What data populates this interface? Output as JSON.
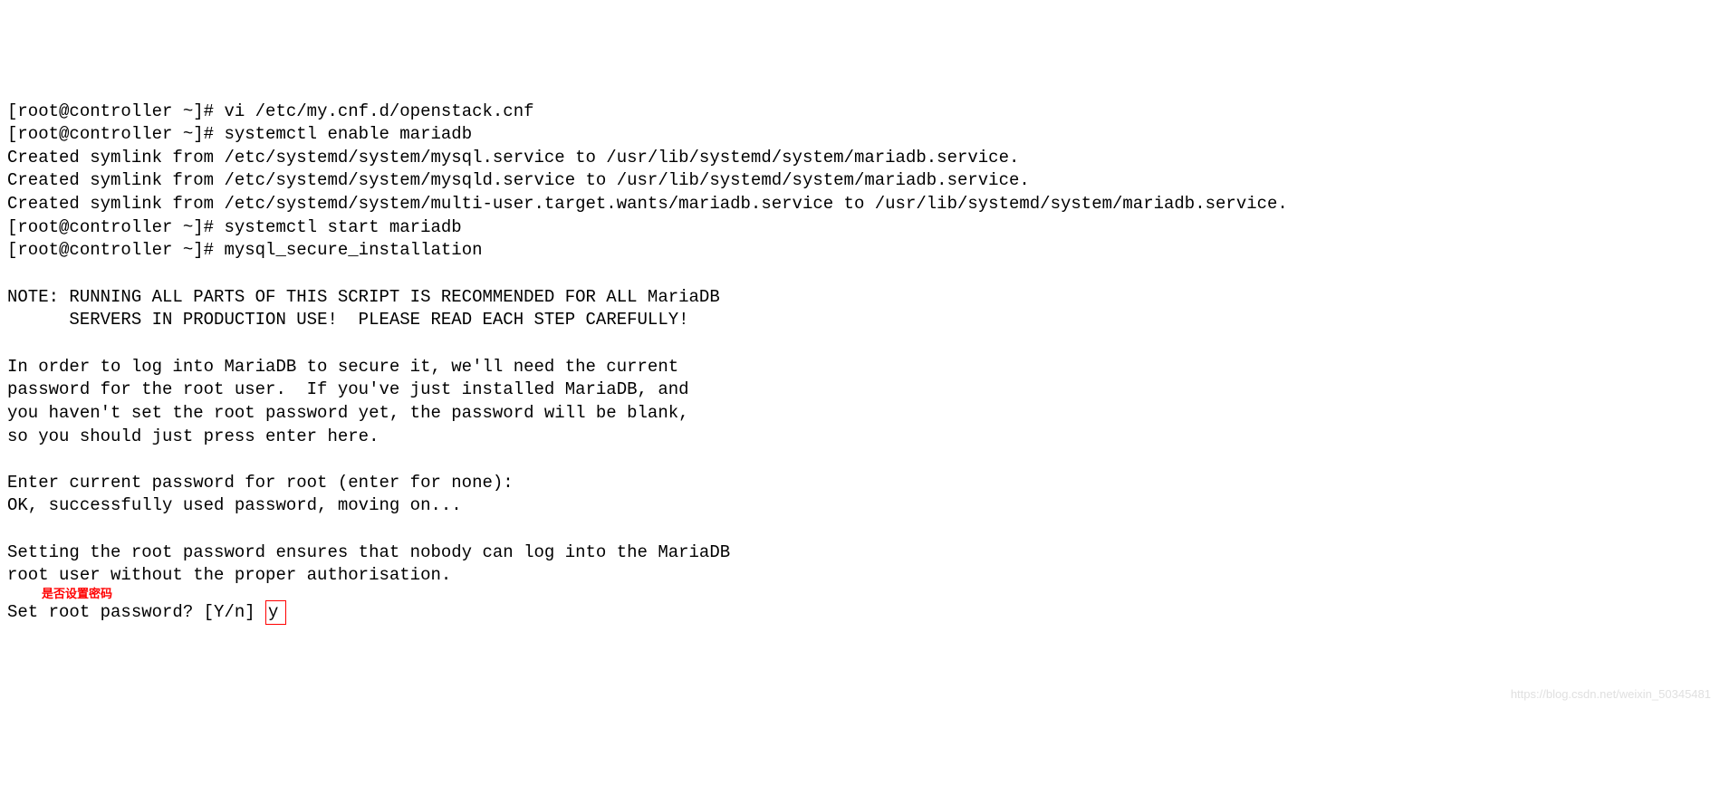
{
  "prompt": "[root@controller ~]# ",
  "cmd1": "vi /etc/my.cnf.d/openstack.cnf",
  "cmd2": "systemctl enable mariadb",
  "out1": "Created symlink from /etc/systemd/system/mysql.service to /usr/lib/systemd/system/mariadb.service.",
  "out2": "Created symlink from /etc/systemd/system/mysqld.service to /usr/lib/systemd/system/mariadb.service.",
  "out3": "Created symlink from /etc/systemd/system/multi-user.target.wants/mariadb.service to /usr/lib/systemd/system/mariadb.service.",
  "cmd3": "systemctl start mariadb",
  "cmd4": "mysql_secure_installation",
  "blank": "",
  "note1": "NOTE: RUNNING ALL PARTS OF THIS SCRIPT IS RECOMMENDED FOR ALL MariaDB",
  "note2": "      SERVERS IN PRODUCTION USE!  PLEASE READ EACH STEP CAREFULLY!",
  "para1": "In order to log into MariaDB to secure it, we'll need the current",
  "para2": "password for the root user.  If you've just installed MariaDB, and",
  "para3": "you haven't set the root password yet, the password will be blank,",
  "para4": "so you should just press enter here.",
  "enter_pw": "Enter current password for root (enter for none):",
  "ok_line": "OK, successfully used password, moving on...",
  "set1": "Setting the root password ensures that nobody can log into the MariaDB",
  "set2": "root user without the proper authorisation.",
  "annotation": "是否设置密码",
  "question": "Set root password? [Y/n] ",
  "answer": "y",
  "watermark": "https://blog.csdn.net/weixin_50345481"
}
